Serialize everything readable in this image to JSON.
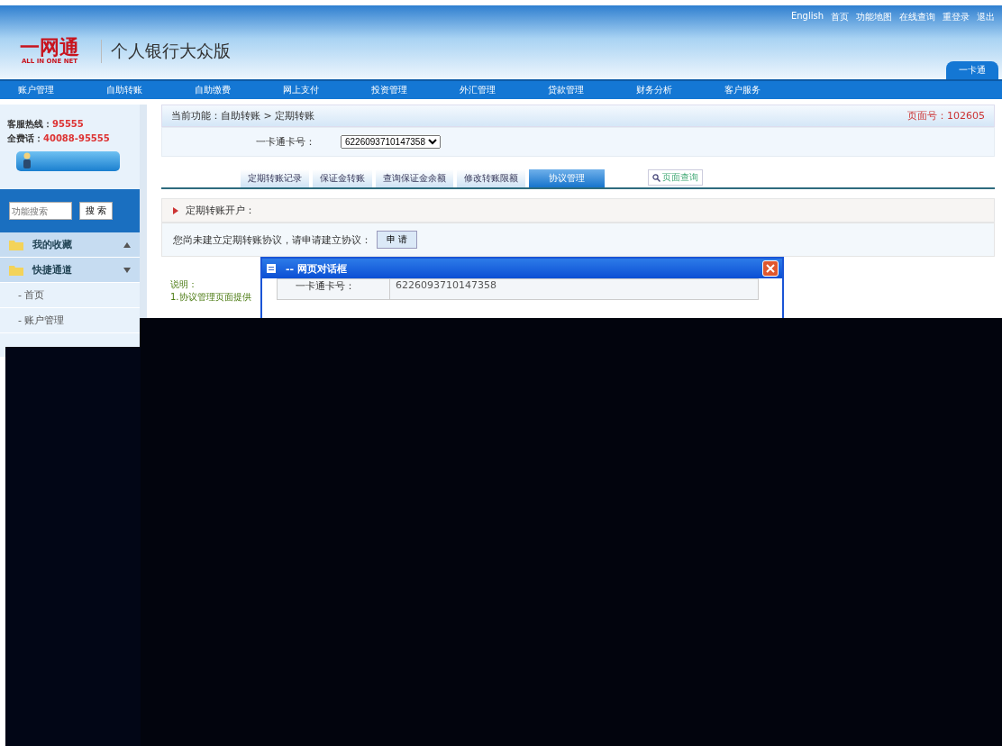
{
  "header": {
    "logo": "一网通",
    "logo_sub": "ALL IN ONE NET",
    "title": "个人银行大众版",
    "top_links": [
      "English",
      "首页",
      "功能地图",
      "在线查询",
      "重登录",
      "退出"
    ],
    "card_tab": "一卡通"
  },
  "nav": [
    "账户管理",
    "自助转账",
    "自助缴费",
    "网上支付",
    "投资管理",
    "外汇管理",
    "贷款管理",
    "财务分析",
    "客户服务"
  ],
  "sidebar": {
    "hotline_label": "客服热线：",
    "hotline": "95555",
    "phone_label": "全费话：",
    "phone": "40088-95555",
    "search": {
      "placeholder": "功能搜索",
      "button": "搜 索"
    },
    "sections": [
      {
        "label": "我的收藏",
        "expanded": false
      },
      {
        "label": "快捷通道",
        "expanded": true
      }
    ],
    "items": [
      "- 首页",
      "- 账户管理"
    ]
  },
  "breadcrumb": "当前功能：自助转账 > 定期转账",
  "page_no": "页面号：102605",
  "card_field": {
    "label": "一卡通卡号：",
    "value": "6226093710147358"
  },
  "tabs": [
    {
      "label": "定期转账记录",
      "selected": false
    },
    {
      "label": "保证金转账",
      "selected": false
    },
    {
      "label": "查询保证金余额",
      "selected": false
    },
    {
      "label": "修改转账限额",
      "selected": false
    },
    {
      "label": "协议管理",
      "selected": true
    }
  ],
  "page_search": "页面查询",
  "section": {
    "title": "定期转账开户：",
    "text": "您尚未建立定期转账协议，请申请建立协议：",
    "button": "申 请"
  },
  "note": {
    "title": "说明：",
    "line": "1.协议管理页面提供"
  },
  "dialog": {
    "title": "-- 网页对话框",
    "label": "一卡通卡号：",
    "value": "6226093710147358"
  }
}
